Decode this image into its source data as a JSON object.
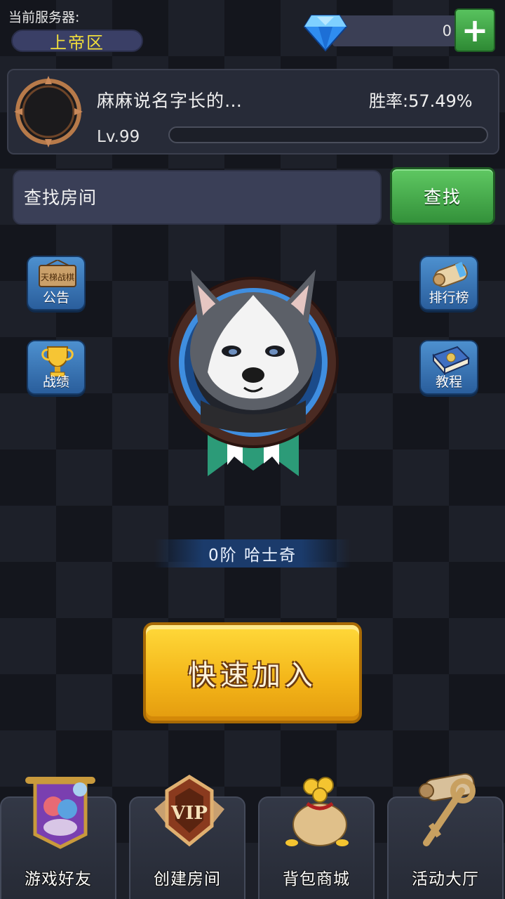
{
  "server": {
    "label": "当前服务器:",
    "name": "上帝区"
  },
  "currency": {
    "gems": "0",
    "gem_icon": "diamond-icon",
    "add_icon": "plus-icon"
  },
  "profile": {
    "name": "麻麻说名字长的…",
    "win_rate": "胜率:57.49%",
    "level": "Lv.99",
    "exp_progress": 0
  },
  "search": {
    "placeholder": "查找房间",
    "button_label": "查找"
  },
  "side_buttons": {
    "notice": {
      "label": "公告",
      "sign_text": "天梯战棋",
      "icon": "signboard-icon"
    },
    "leaderboard": {
      "label": "排行榜",
      "icon": "scroll-icon"
    },
    "record": {
      "label": "战绩",
      "icon": "trophy-icon"
    },
    "tutorial": {
      "label": "教程",
      "icon": "book-icon"
    }
  },
  "pet": {
    "rank": "0阶",
    "name": "哈士奇",
    "rank_text": "0阶  哈士奇",
    "icon": "husky-avatar"
  },
  "quick_join": {
    "label": "快速加入"
  },
  "bottom_nav": [
    {
      "label": "游戏好友",
      "icon": "friends-banner-icon"
    },
    {
      "label": "创建房间",
      "icon": "vip-badge-icon"
    },
    {
      "label": "背包商城",
      "icon": "money-bag-icon"
    },
    {
      "label": "活动大厅",
      "icon": "key-scroll-icon"
    }
  ],
  "colors": {
    "accent_green": "#3a9a40",
    "accent_yellow": "#f3b418",
    "server_text": "#f1de3c",
    "side_button_blue": "#3a76b6"
  }
}
